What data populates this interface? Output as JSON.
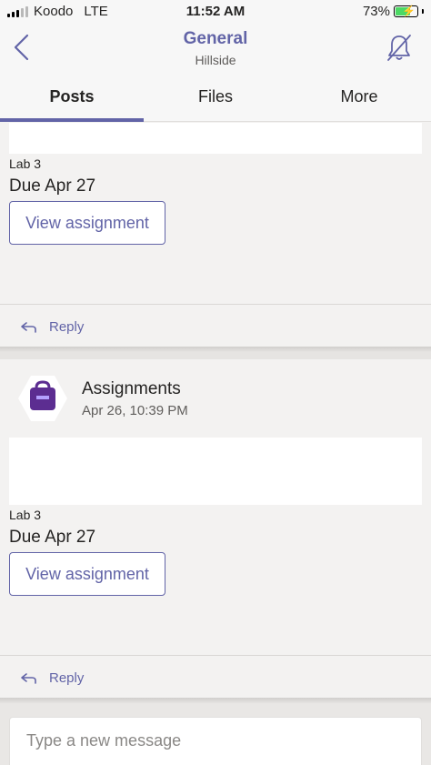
{
  "status_bar": {
    "carrier": "Koodo",
    "network": "LTE",
    "time": "11:52 AM",
    "battery": "73%",
    "battery_level": 0.73
  },
  "header": {
    "title": "General",
    "subtitle": "Hillside"
  },
  "tabs": [
    {
      "label": "Posts",
      "active": true
    },
    {
      "label": "Files",
      "active": false
    },
    {
      "label": "More",
      "active": false
    }
  ],
  "posts": [
    {
      "lab": "Lab 3",
      "due": "Due Apr 27",
      "button": "View assignment",
      "reply": "Reply"
    },
    {
      "sender": "Assignments",
      "timestamp": "Apr 26, 10:39 PM",
      "lab": "Lab 3",
      "due": "Due Apr 27",
      "button": "View assignment",
      "reply": "Reply"
    }
  ],
  "compose": {
    "placeholder": "Type a new message"
  },
  "colors": {
    "accent": "#6264a7",
    "background": "#f3f2f1",
    "assignments_icon": "#5c2d91"
  },
  "icons": {
    "back": "chevron-left-icon",
    "mute": "bell-off-icon",
    "reply": "reply-arrow-icon",
    "assignments": "backpack-icon"
  }
}
